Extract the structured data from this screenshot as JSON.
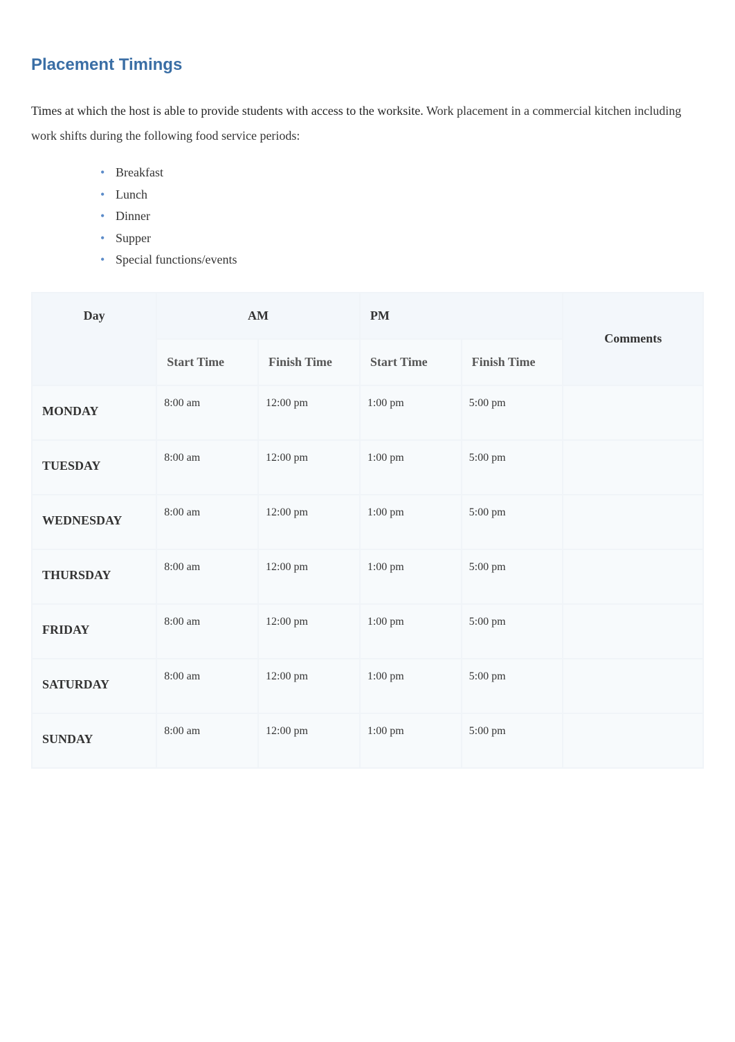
{
  "section": {
    "title": "Placement Timings",
    "intro_dark": "Times at which the host is able to provide students with access to the worksite. ",
    "intro_rest": "Work placement in a commercial kitchen including work shifts during the following food service periods:",
    "bullets": [
      "Breakfast",
      "Lunch",
      "Dinner",
      "Supper",
      "Special functions/events"
    ]
  },
  "table": {
    "headers": {
      "day": "Day",
      "am": "AM",
      "pm": "PM",
      "comments": "Comments",
      "start": "Start Time",
      "finish": "Finish Time"
    },
    "rows": [
      {
        "day": "MONDAY",
        "am_start": "8:00 am",
        "am_finish": "12:00 pm",
        "pm_start": "1:00 pm",
        "pm_finish": "5:00 pm",
        "comment": ""
      },
      {
        "day": "TUESDAY",
        "am_start": "8:00 am",
        "am_finish": "12:00 pm",
        "pm_start": "1:00 pm",
        "pm_finish": "5:00 pm",
        "comment": ""
      },
      {
        "day": "WEDNESDAY",
        "am_start": "8:00 am",
        "am_finish": "12:00 pm",
        "pm_start": "1:00 pm",
        "pm_finish": "5:00 pm",
        "comment": ""
      },
      {
        "day": "THURSDAY",
        "am_start": "8:00 am",
        "am_finish": "12:00 pm",
        "pm_start": "1:00 pm",
        "pm_finish": "5:00 pm",
        "comment": ""
      },
      {
        "day": "FRIDAY",
        "am_start": "8:00 am",
        "am_finish": "12:00 pm",
        "pm_start": "1:00 pm",
        "pm_finish": "5:00 pm",
        "comment": ""
      },
      {
        "day": "SATURDAY",
        "am_start": "8:00 am",
        "am_finish": "12:00 pm",
        "pm_start": "1:00 pm",
        "pm_finish": "5:00 pm",
        "comment": ""
      },
      {
        "day": "SUNDAY",
        "am_start": "8:00 am",
        "am_finish": "12:00 pm",
        "pm_start": "1:00 pm",
        "pm_finish": "5:00 pm",
        "comment": ""
      }
    ]
  }
}
